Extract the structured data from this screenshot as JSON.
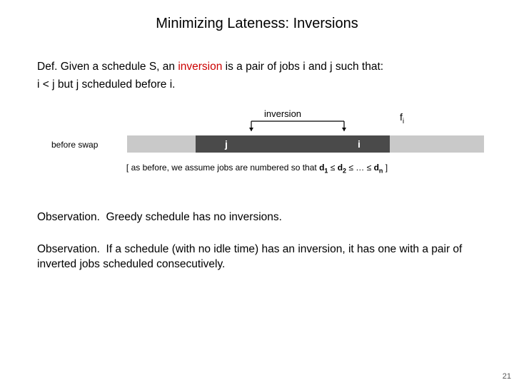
{
  "title": "Minimizing Lateness: Inversions",
  "def": {
    "lead": "Def.",
    "line1_a": "Given a schedule S, an ",
    "line1_em": "inversion",
    "line1_b": " is a pair of jobs i and j such that:",
    "line2": "i < j but j scheduled before i."
  },
  "inversion_label": "inversion",
  "fi_label": "f",
  "fi_sub": "i",
  "before_swap": "before swap",
  "bar": {
    "j": "j",
    "i": "i"
  },
  "assume": {
    "prefix": "[ as before, we assume jobs are numbered so that ",
    "d1": "d",
    "s1": "1",
    "le1": " ≤ ",
    "d2": "d",
    "s2": "2",
    "le2": " ≤  …  ≤ ",
    "dn": "d",
    "sn": "n",
    "suffix": " ]"
  },
  "obs1": {
    "lead": "Observation.",
    "text": "Greedy schedule has no inversions."
  },
  "obs2": {
    "lead": "Observation.",
    "text": "If a schedule (with no idle time) has an inversion, it has one with a pair of inverted jobs scheduled consecutively."
  },
  "pageno": "21"
}
